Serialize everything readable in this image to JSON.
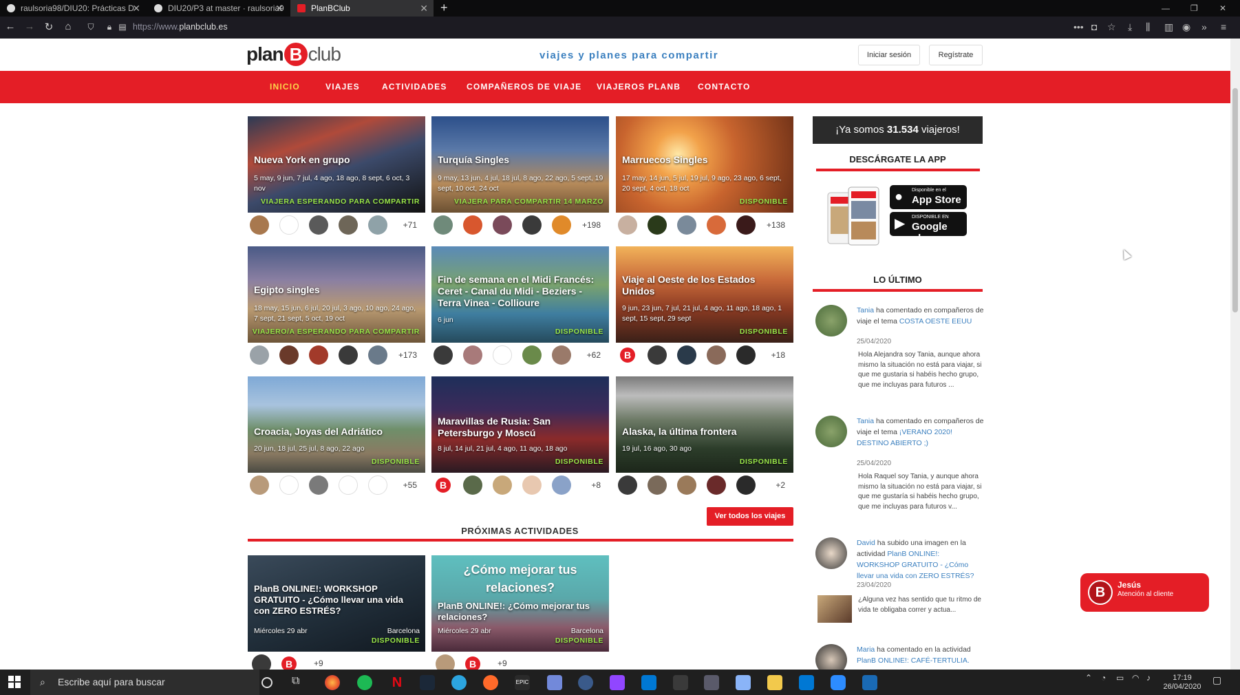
{
  "browser": {
    "tabs": [
      {
        "label": "raulsoria98/DIU20: Prácticas D",
        "active": false
      },
      {
        "label": "DIU20/P3 at master · raulsoria9",
        "active": false
      },
      {
        "label": "PlanBClub",
        "active": true
      }
    ],
    "url_prefix": "https://www.",
    "url_domain": "planbclub.es"
  },
  "header": {
    "logo_plan": "plan",
    "logo_b": "B",
    "logo_club": "club",
    "tagline": "viajes y planes para compartir",
    "login_label": "Iniciar sesión",
    "register_label": "Regístrate"
  },
  "menu": [
    "INICIO",
    "VIAJES",
    "ACTIVIDADES",
    "COMPAÑEROS DE VIAJE",
    "VIAJEROS PLANB",
    "CONTACTO"
  ],
  "trips": [
    {
      "title": "Nueva York en grupo",
      "dates": "5 may, 9 jun, 7 jul, 4 ago, 18 ago, 8 sept, 6 oct, 3 nov",
      "status": "VIAJERA ESPERANDO PARA COMPARTIR",
      "count": "+71"
    },
    {
      "title": "Turquía Singles",
      "dates": "9 may, 13 jun, 4 jul, 18 jul, 8 ago, 22 ago, 5 sept, 19 sept, 10 oct, 24 oct",
      "status": "VIAJERA PARA COMPARTIR 14 MARZO",
      "count": "+198"
    },
    {
      "title": "Marruecos Singles",
      "dates": "17 may, 14 jun, 5 jul, 19 jul, 9 ago, 23 ago, 6 sept, 20 sept, 4 oct, 18 oct",
      "status": "DISPONIBLE",
      "count": "+138"
    },
    {
      "title": "Egipto singles",
      "dates": "18 may, 15 jun, 6 jul, 20 jul, 3 ago, 10 ago, 24 ago, 7 sept, 21 sept, 5 oct, 19 oct",
      "status": "VIAJERO/A ESPERANDO PARA COMPARTIR",
      "count": "+173"
    },
    {
      "title": "Fin de semana en el Midi Francés: Ceret - Canal du Midi - Beziers - Terra Vinea - Collioure",
      "dates": "6 jun",
      "status": "DISPONIBLE",
      "count": "+62"
    },
    {
      "title": "Viaje al Oeste de los Estados Unidos",
      "dates": "9 jun, 23 jun, 7 jul, 21 jul, 4 ago, 11 ago, 18 ago, 1 sept, 15 sept, 29 sept",
      "status": "DISPONIBLE",
      "count": "+18"
    },
    {
      "title": "Croacia, Joyas del Adriático",
      "dates": "20 jun, 18 jul, 25 jul, 8 ago, 22 ago",
      "status": "DISPONIBLE",
      "count": "+55"
    },
    {
      "title": "Maravillas de Rusia: San Petersburgo y Moscú",
      "dates": "8 jul, 14 jul, 21 jul, 4 ago, 11 ago, 18 ago",
      "status": "DISPONIBLE",
      "count": "+8"
    },
    {
      "title": "Alaska, la última frontera",
      "dates": "19 jul, 16 ago, 30 ago",
      "status": "DISPONIBLE",
      "count": "+2"
    }
  ],
  "see_all_trips": "Ver todos los viajes",
  "activities_title": "PRÓXIMAS ACTIVIDADES",
  "activities": [
    {
      "banner": "",
      "title": "PlanB ONLINE!: WORKSHOP GRATUITO - ¿Cómo llevar una vida con ZERO ESTRÉS?",
      "date": "Miércoles 29 abr",
      "city": "Barcelona",
      "status": "DISPONIBLE",
      "count": "+9"
    },
    {
      "banner": "¿Cómo mejorar tus relaciones?",
      "title": "PlanB ONLINE!: ¿Cómo mejorar tus relaciones?",
      "date": "Miércoles 29 abr",
      "city": "Barcelona",
      "status": "DISPONIBLE",
      "count": "+9"
    }
  ],
  "sidebar": {
    "banner_pre": "¡Ya somos ",
    "banner_num": "31.534",
    "banner_post": " viajeros!",
    "app_title": "DESCÁRGATE LA APP",
    "appstore_small": "Disponible en el",
    "appstore_big": "App Store",
    "gplay_small": "DISPONIBLE EN",
    "gplay_big": "Google play",
    "latest_title": "LO ÚLTIMO",
    "feed": [
      {
        "name": "Tania",
        "action": " ha comentado en compañeros de viaje el tema ",
        "link": "COSTA OESTE EEUU",
        "date": "25/04/2020",
        "msg": "Hola Alejandra soy Tania, aunque ahora mismo la situación no está para viajar, si que me gustaria si habéis hecho grupo, que me incluyas para futuros ..."
      },
      {
        "name": "Tania",
        "action": " ha comentado en compañeros de viaje el tema ",
        "link": "¡VERANO 2020! DESTINO ABIERTO ;)",
        "date": "25/04/2020",
        "msg": "Hola Raquel soy Tania, y aunque ahora mismo la situación no está para viajar, si que me gustaría si habéis hecho grupo, que me incluyas para futuros v..."
      },
      {
        "name": "David",
        "action": " ha subido una imagen en la actividad ",
        "link": "PlanB ONLINE!: WORKSHOP GRATUITO - ¿Cómo llevar una vida con ZERO ESTRÉS?",
        "date": "23/04/2020",
        "msg": "¿Alguna vez has sentido que tu ritmo de vida te obligaba correr y actua..."
      },
      {
        "name": "Maria",
        "action": " ha comentado en la actividad ",
        "link": "PlanB ONLINE!: CAFÉ-TERTULIA.",
        "date": "",
        "msg": ""
      }
    ]
  },
  "chat": {
    "name": "Jesús",
    "subtitle": "Atención al cliente"
  },
  "taskbar": {
    "search_placeholder": "Escribe aquí para buscar",
    "time": "17:19",
    "date": "26/04/2020"
  },
  "colors": {
    "brand_red": "#e41e26",
    "menu_active": "#fcd64b",
    "link_blue": "#3a7fbf",
    "status_green": "#9be84a"
  }
}
